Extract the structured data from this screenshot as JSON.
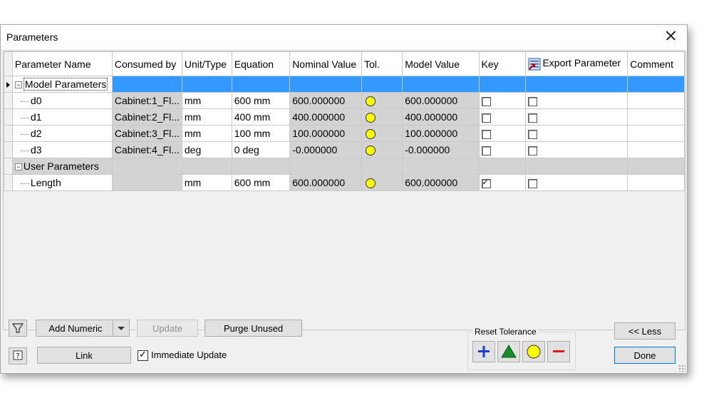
{
  "window": {
    "title": "Parameters"
  },
  "columns": [
    "Parameter Name",
    "Consumed by",
    "Unit/Type",
    "Equation",
    "Nominal Value",
    "Tol.",
    "Model Value",
    "Key",
    "Export Parameter",
    "Comment"
  ],
  "groups": [
    {
      "name": "Model Parameters",
      "rows": [
        {
          "name": "d0",
          "consumed": "Cabinet:1_Fl...",
          "unit": "mm",
          "equation": "600 mm",
          "nominal": "600.000000",
          "model": "600.000000",
          "key": false,
          "export": false,
          "comment": ""
        },
        {
          "name": "d1",
          "consumed": "Cabinet:2_Fl...",
          "unit": "mm",
          "equation": "400 mm",
          "nominal": "400.000000",
          "model": "400.000000",
          "key": false,
          "export": false,
          "comment": ""
        },
        {
          "name": "d2",
          "consumed": "Cabinet:3_Fl...",
          "unit": "mm",
          "equation": "100 mm",
          "nominal": "100.000000",
          "model": "100.000000",
          "key": false,
          "export": false,
          "comment": ""
        },
        {
          "name": "d3",
          "consumed": "Cabinet:4_Fl...",
          "unit": "deg",
          "equation": "0 deg",
          "nominal": "-0.000000",
          "model": "-0.000000",
          "key": false,
          "export": false,
          "comment": ""
        }
      ]
    },
    {
      "name": "User Parameters",
      "rows": [
        {
          "name": "Length",
          "consumed": "",
          "unit": "mm",
          "equation": "600 mm",
          "nominal": "600.000000",
          "model": "600.000000",
          "key": true,
          "export": false,
          "comment": ""
        }
      ]
    }
  ],
  "buttons": {
    "add_numeric": "Add Numeric",
    "update": "Update",
    "purge_unused": "Purge Unused",
    "link": "Link",
    "immediate_update": "Immediate Update",
    "less": "<< Less",
    "done": "Done"
  },
  "reset_tolerance": {
    "label": "Reset Tolerance"
  },
  "colors": {
    "selection": "#3399ff",
    "readonly_cell": "#d3d3d3",
    "tolerance_dot": "#ffff00"
  }
}
